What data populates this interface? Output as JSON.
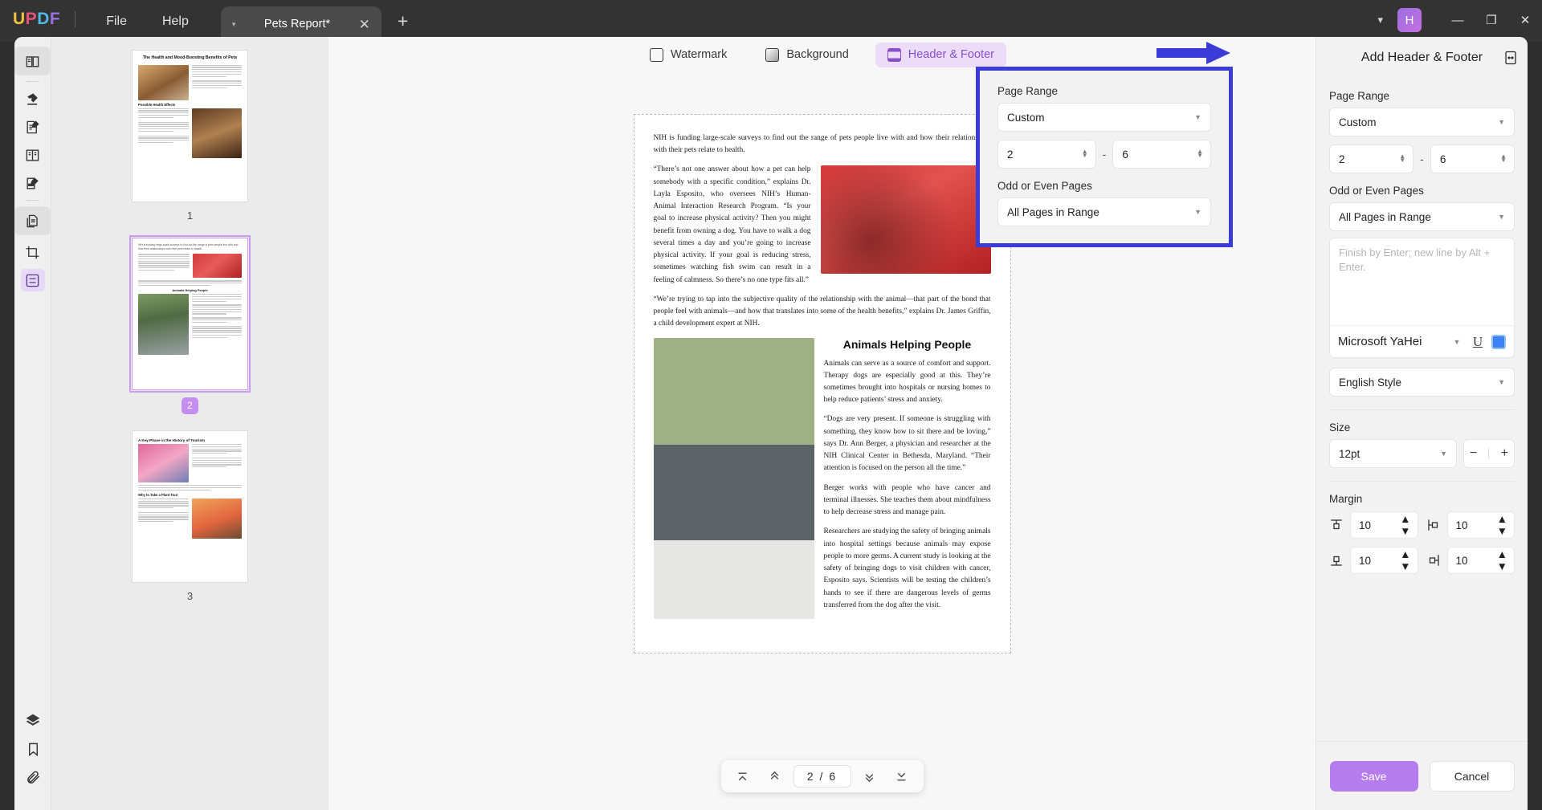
{
  "titlebar": {
    "logo_letters": [
      "U",
      "P",
      "D",
      "F"
    ],
    "menus": [
      "File",
      "Help"
    ],
    "tab": {
      "title": "Pets Report*",
      "caret": "▾",
      "close": "✕"
    },
    "new_tab": "+",
    "chevron": "▾",
    "avatar_letter": "H",
    "window_buttons": [
      "—",
      "❐",
      "✕"
    ]
  },
  "rail": {
    "items": [
      {
        "name": "reader-icon",
        "label": "Reader"
      },
      {
        "name": "highlighter-icon",
        "label": "Highlight"
      },
      {
        "name": "edit-pdf-icon",
        "label": "Edit PDF"
      },
      {
        "name": "comment-icon",
        "label": "Comment"
      },
      {
        "name": "annotate-icon",
        "label": "Annotate"
      },
      {
        "name": "organize-pages-icon",
        "label": "Organize Pages"
      },
      {
        "name": "crop-icon",
        "label": "Crop"
      },
      {
        "name": "page-tools-icon",
        "label": "Page Tools"
      }
    ],
    "bottom_items": [
      {
        "name": "layers-icon",
        "label": "Layers"
      },
      {
        "name": "bookmark-icon",
        "label": "Bookmark"
      },
      {
        "name": "attachment-icon",
        "label": "Attachment"
      }
    ]
  },
  "thumbnails": {
    "pages": [
      {
        "number": "1",
        "active": false,
        "title": "The Health and Mood-Boosting Benefits of Pets",
        "subtitle": "Possible Health Effects"
      },
      {
        "number": "2",
        "active": true,
        "title": "",
        "subtitle": "Animals Helping People"
      },
      {
        "number": "3",
        "active": false,
        "title": "A Key Phase in the History of Tourism",
        "subtitle": "Why to Take a Plant Tour"
      }
    ]
  },
  "toolstrip": {
    "tools": [
      {
        "label": "Watermark",
        "icon": "watermark-icon",
        "active": false
      },
      {
        "label": "Background",
        "icon": "background-icon",
        "active": false
      },
      {
        "label": "Header & Footer",
        "icon": "header-footer-icon",
        "active": true
      }
    ]
  },
  "document": {
    "paragraphs": [
      "NIH is funding large-scale surveys to find out the range of pets people live with and how their relationships with their pets relate to health.",
      "“There’s not one answer about how a pet can help somebody with a specific condition,” explains Dr. Layla Esposito, who oversees NIH’s Human-Animal Interaction Research Program. “Is your goal to increase physical activity? Then you might benefit from owning a dog. You have to walk a dog several times a day and you’re going to increase physical activity. If your goal is reducing stress, sometimes watching fish swim can result in a feeling of calmness. So there’s no one type fits all.”",
      "“We’re trying to tap into the subjective quality of the relationship with the animal—that part of the bond that people feel with animals—and how that translates into some of the health benefits,” explains Dr. James Griffin, a child development expert at NIH."
    ],
    "section_heading": "Animals Helping People",
    "section_paragraphs": [
      "Animals can serve as a source of comfort and support. Therapy dogs are especially good at this. They’re sometimes brought into hospitals or nursing homes to help reduce patients’ stress and anxiety.",
      "“Dogs are very present. If someone is struggling with something, they know how to sit there and be loving,” says Dr. Ann Berger, a physician and researcher at the NIH Clinical Center in Bethesda, Maryland. “Their attention is focused on the person all the time.”",
      "Berger works with people who have cancer and terminal illnesses. She teaches them about mindfulness to help decrease stress and manage pain.",
      "Researchers are studying the safety of bringing animals into hospital settings because animals may expose people to more germs. A current study is looking at the safety of bringing dogs to visit children with cancer, Esposito says. Scientists will be testing the children’s hands to see if there are dangerous levels of germs transferred from the dog after the visit."
    ]
  },
  "pagenav": {
    "first": "first-page",
    "prev": "previous-page",
    "value": "2 / 6",
    "next": "next-page",
    "last": "last-page"
  },
  "right_panel": {
    "title": "Add Header & Footer",
    "expand_icon": "expand-panel-icon",
    "page_range": {
      "label": "Page Range",
      "mode_value": "Custom",
      "from_value": "2",
      "to_value": "6",
      "separator": "-",
      "odd_even_label": "Odd or Even Pages",
      "odd_even_value": "All Pages in Range"
    },
    "text_editor": {
      "placeholder": "Finish by Enter; new line by Alt + Enter.",
      "font_family": "Microsoft YaHei",
      "underline_icon": "underline-icon",
      "color_swatch": "#3b82f6"
    },
    "style": {
      "value": "English Style"
    },
    "size": {
      "label": "Size",
      "value": "12pt",
      "minus": "−",
      "plus": "+"
    },
    "margin": {
      "label": "Margin",
      "top": "10",
      "bottom": "10",
      "left": "10",
      "right": "10"
    },
    "footer": {
      "save": "Save",
      "cancel": "Cancel"
    }
  },
  "colors": {
    "accent_purple": "#b57ced",
    "highlight_blue": "#3b3bd8",
    "active_tab_bg": "#ecdcfa",
    "active_tab_text": "#8650c9"
  }
}
